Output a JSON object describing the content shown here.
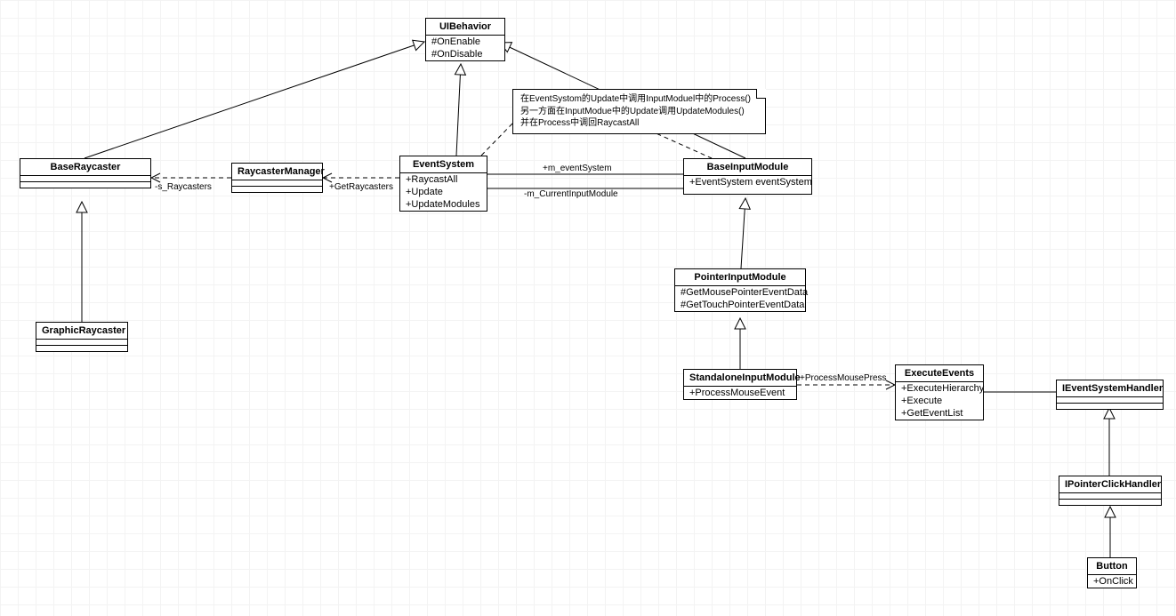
{
  "classes": {
    "uiBehavior": {
      "name": "UIBehavior",
      "members": [
        "#OnEnable",
        "#OnDisable"
      ]
    },
    "baseRaycaster": {
      "name": "BaseRaycaster",
      "members": []
    },
    "raycasterManager": {
      "name": "RaycasterManager",
      "members": []
    },
    "eventSystem": {
      "name": "EventSystem",
      "members": [
        "+RaycastAll",
        "+Update",
        "+UpdateModules"
      ]
    },
    "baseInputModule": {
      "name": "BaseInputModule",
      "members": [
        "+EventSystem eventSystem"
      ]
    },
    "graphicRaycaster": {
      "name": "GraphicRaycaster",
      "members": []
    },
    "pointerInputModule": {
      "name": "PointerInputModule",
      "members": [
        "#GetMousePointerEventData",
        "#GetTouchPointerEventData"
      ]
    },
    "standaloneInputModule": {
      "name": "StandaloneInputModule",
      "members": [
        "+ProcessMouseEvent"
      ]
    },
    "executeEvents": {
      "name": "ExecuteEvents",
      "members": [
        "+ExecuteHierarchy",
        "+Execute",
        "+GetEventList"
      ]
    },
    "iEventSystemHandler": {
      "name": "IEventSystemHandler",
      "members": []
    },
    "iPointerClickHandler": {
      "name": "IPointerClickHandler",
      "members": []
    },
    "button": {
      "name": "Button",
      "members": [
        "+OnClick"
      ]
    }
  },
  "note": {
    "l1": "在EventSystom的Update中调用InputModuel中的Process()",
    "l2": "另一方面在InputModue中的Update调用UpdateModules()",
    "l3": "并在Process中调回RaycastAll"
  },
  "labels": {
    "sRaycasters": "-s_Raycasters",
    "getRaycasters": "+GetRaycasters",
    "mEventSystem": "+m_eventSystem",
    "mCurrentInputModule": "-m_CurrentInputModule",
    "processMousePress": "+ProcessMousePress"
  }
}
